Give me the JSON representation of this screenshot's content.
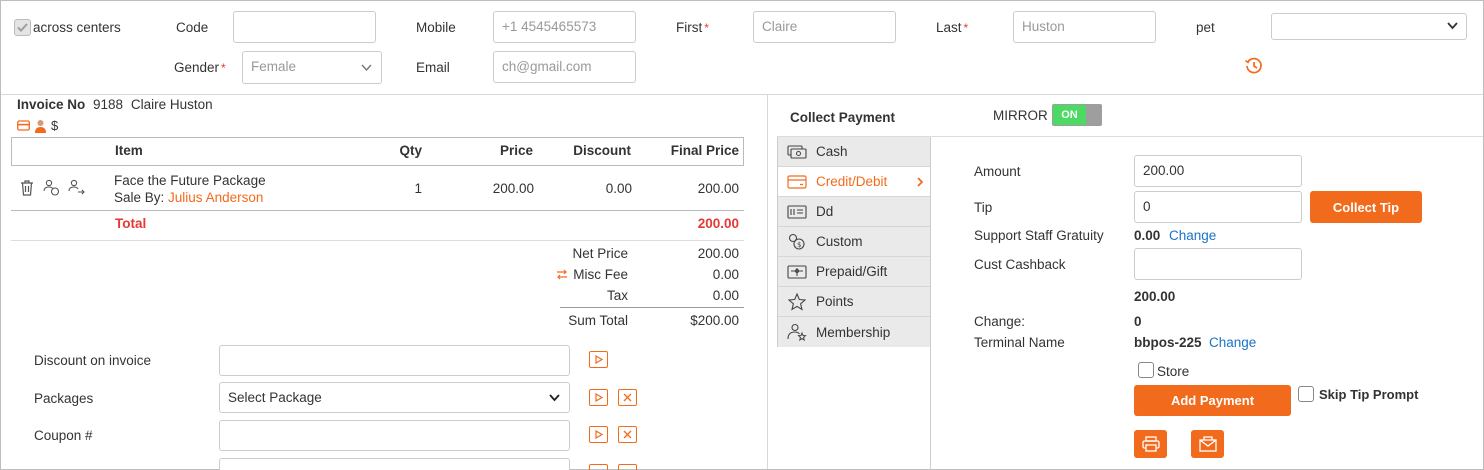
{
  "customer": {
    "across_centers_label": "across centers",
    "code_label": "Code",
    "code_value": "",
    "mobile_label": "Mobile",
    "mobile_value": "+1 4545465573",
    "first_label": "First",
    "first_value": "Claire",
    "last_label": "Last",
    "last_value": "Huston",
    "pet_label": "pet",
    "pet_value": "",
    "gender_label": "Gender",
    "gender_value": "Female",
    "email_label": "Email",
    "email_value": "ch@gmail.com",
    "required_mark": "*"
  },
  "invoice": {
    "invoice_no_label": "Invoice No",
    "invoice_no": "9188",
    "customer_name": "Claire Huston",
    "dollar": "$",
    "columns": {
      "item": "Item",
      "qty": "Qty",
      "price": "Price",
      "discount": "Discount",
      "final_price": "Final Price"
    },
    "row": {
      "item": "Face the Future Package",
      "sale_by_label": "Sale By:",
      "sale_by": "Julius Anderson",
      "qty": "1",
      "price": "200.00",
      "discount": "0.00",
      "final_price": "200.00"
    },
    "total_label": "Total",
    "total_value": "200.00",
    "summary": {
      "net_price_label": "Net Price",
      "net_price": "200.00",
      "misc_fee_label": "Misc Fee",
      "misc_fee": "0.00",
      "tax_label": "Tax",
      "tax": "0.00",
      "sum_total_label": "Sum Total",
      "sum_total": "$200.00"
    },
    "discount_label": "Discount on invoice",
    "discount_value": "",
    "packages_label": "Packages",
    "packages_value": "Select Package",
    "coupon_label": "Coupon #",
    "coupon_value": ""
  },
  "payment": {
    "title": "Collect Payment",
    "mirror_label": "MIRROR",
    "mirror_state": "ON",
    "methods": [
      {
        "label": "Cash",
        "icon": "cash-icon"
      },
      {
        "label": "Credit/Debit",
        "icon": "credit-card-icon"
      },
      {
        "label": "Dd",
        "icon": "dd-icon"
      },
      {
        "label": "Custom",
        "icon": "custom-icon"
      },
      {
        "label": "Prepaid/Gift",
        "icon": "gift-card-icon"
      },
      {
        "label": "Points",
        "icon": "star-icon"
      },
      {
        "label": "Membership",
        "icon": "membership-icon"
      }
    ],
    "amount_label": "Amount",
    "amount_value": "200.00",
    "tip_label": "Tip",
    "tip_value": "0",
    "collect_tip_label": "Collect Tip",
    "gratuity_label": "Support Staff Gratuity",
    "gratuity_value": "0.00",
    "change_link": "Change",
    "cashback_label": "Cust Cashback",
    "cashback_value": "",
    "subtotal": "200.00",
    "change_label": "Change:",
    "change_value": "0",
    "terminal_label": "Terminal Name",
    "terminal_value": "bbpos-225",
    "store_label": "Store",
    "add_payment_label": "Add Payment",
    "skip_tip_label": "Skip Tip Prompt"
  },
  "colors": {
    "accent": "#f26b1d",
    "link": "#1a73c8",
    "total": "#e53935",
    "toggle_on": "#4cd964"
  }
}
